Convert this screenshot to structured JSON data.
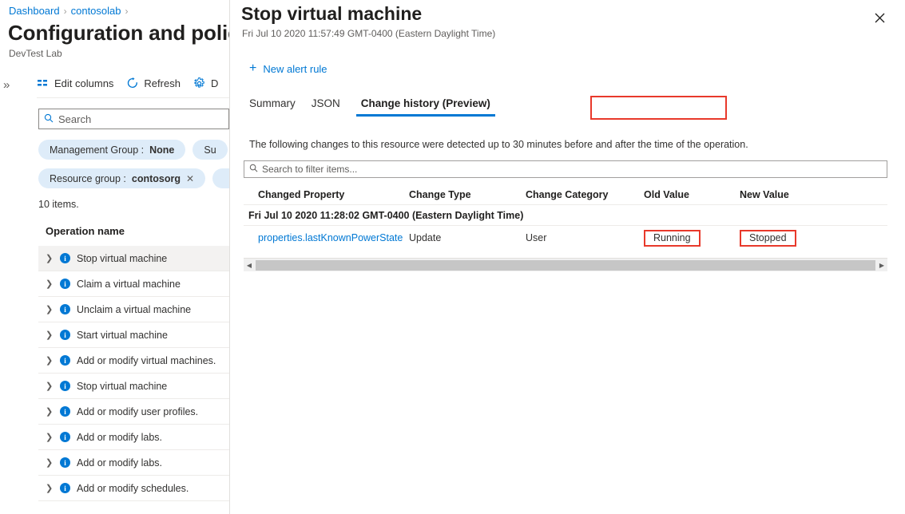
{
  "background_page": {
    "breadcrumb": {
      "items": [
        "Dashboard",
        "contosolab"
      ],
      "separator": "›"
    },
    "title": "Configuration and policies",
    "subtitle": "DevTest Lab",
    "expander_icon": "»",
    "commands": [
      {
        "label": "Edit columns",
        "icon": "edit-columns-icon"
      },
      {
        "label": "Refresh",
        "icon": "refresh-icon"
      },
      {
        "label": "D",
        "icon": "gear-icon"
      }
    ],
    "search": {
      "placeholder": "Search",
      "value": "",
      "icon": "search-icon"
    },
    "filters": [
      {
        "label": "Management Group :",
        "value": "None",
        "removable": false
      },
      {
        "label": "Su",
        "value": "",
        "removable": false
      },
      {
        "label": "Resource group :",
        "value": "contosorg",
        "removable": true
      }
    ],
    "items_count": "10 items.",
    "column_header": "Operation name",
    "operations": [
      {
        "label": "Stop virtual machine",
        "selected": true
      },
      {
        "label": "Claim a virtual machine",
        "selected": false
      },
      {
        "label": "Unclaim a virtual machine",
        "selected": false
      },
      {
        "label": "Start virtual machine",
        "selected": false
      },
      {
        "label": "Add or modify virtual machines.",
        "selected": false
      },
      {
        "label": "Stop virtual machine",
        "selected": false
      },
      {
        "label": "Add or modify user profiles.",
        "selected": false
      },
      {
        "label": "Add or modify labs.",
        "selected": false
      },
      {
        "label": "Add or modify labs.",
        "selected": false
      },
      {
        "label": "Add or modify schedules.",
        "selected": false
      }
    ]
  },
  "blade": {
    "title": "Stop virtual machine",
    "timestamp": "Fri Jul 10 2020 11:57:49 GMT-0400 (Eastern Daylight Time)",
    "close_label": "✕",
    "new_alert_rule": {
      "label": "New alert rule",
      "plus": "+"
    },
    "tabs": [
      {
        "label": "Summary",
        "active": false
      },
      {
        "label": "JSON",
        "active": false
      },
      {
        "label": "Change history (Preview)",
        "active": true,
        "highlighted": true
      }
    ],
    "description": "The following changes to this resource were detected up to 30 minutes before and after the time of the operation.",
    "filter_search": {
      "placeholder": "Search to filter items...",
      "value": "",
      "icon": "search-icon"
    },
    "table": {
      "columns": [
        "Changed Property",
        "Change Type",
        "Change Category",
        "Old Value",
        "New Value"
      ],
      "group_label": "Fri Jul 10 2020 11:28:02 GMT-0400 (Eastern Daylight Time)",
      "rows": [
        {
          "changed_property": "properties.lastKnownPowerState",
          "change_type": "Update",
          "change_category": "User",
          "old_value": "Running",
          "new_value": "Stopped",
          "old_value_highlighted": true,
          "new_value_highlighted": true
        }
      ]
    },
    "scrollbar": {
      "left_arrow": "◀",
      "right_arrow": "▶"
    }
  },
  "colors": {
    "accent_blue": "#0078d4",
    "annotation_red": "#e8392b",
    "pill_bg": "#deecf9",
    "selected_row": "#f3f2f1"
  }
}
